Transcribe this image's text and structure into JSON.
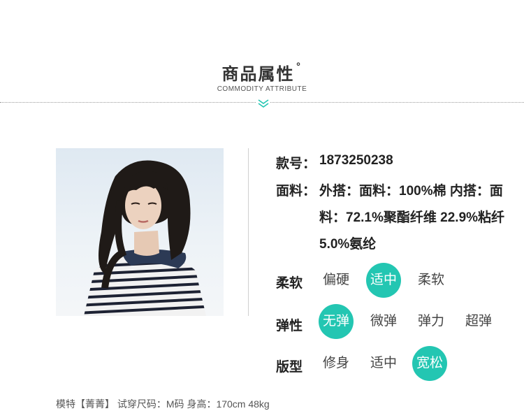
{
  "section": {
    "title": "商品属性",
    "title_mark": "°",
    "subtitle": "COMMODITY ATTRIBUTE"
  },
  "product": {
    "style_label": "款号：",
    "style_value": "1873250238",
    "fabric_label": "面料：",
    "fabric_value": "外搭：面料：100%棉 内搭：面料：72.1%聚酯纤维 22.9%粘纤 5.0%氨纶"
  },
  "attributes": {
    "softness": {
      "label": "柔软",
      "options": [
        "偏硬",
        "适中",
        "柔软"
      ],
      "selected": "适中"
    },
    "elasticity": {
      "label": "弹性",
      "options": [
        "无弹",
        "微弹",
        "弹力",
        "超弹"
      ],
      "selected": "无弹"
    },
    "fit": {
      "label": "版型",
      "options": [
        "修身",
        "适中",
        "宽松"
      ],
      "selected": "宽松"
    }
  },
  "model_info": "模特【菁菁】 试穿尺码：M码 身高：170cm 48kg",
  "colors": {
    "accent": "#23c6b2",
    "text": "#222222",
    "divider": "#9a9a9a"
  },
  "icons": {
    "divider_marker": "double-chevron-down-icon"
  }
}
